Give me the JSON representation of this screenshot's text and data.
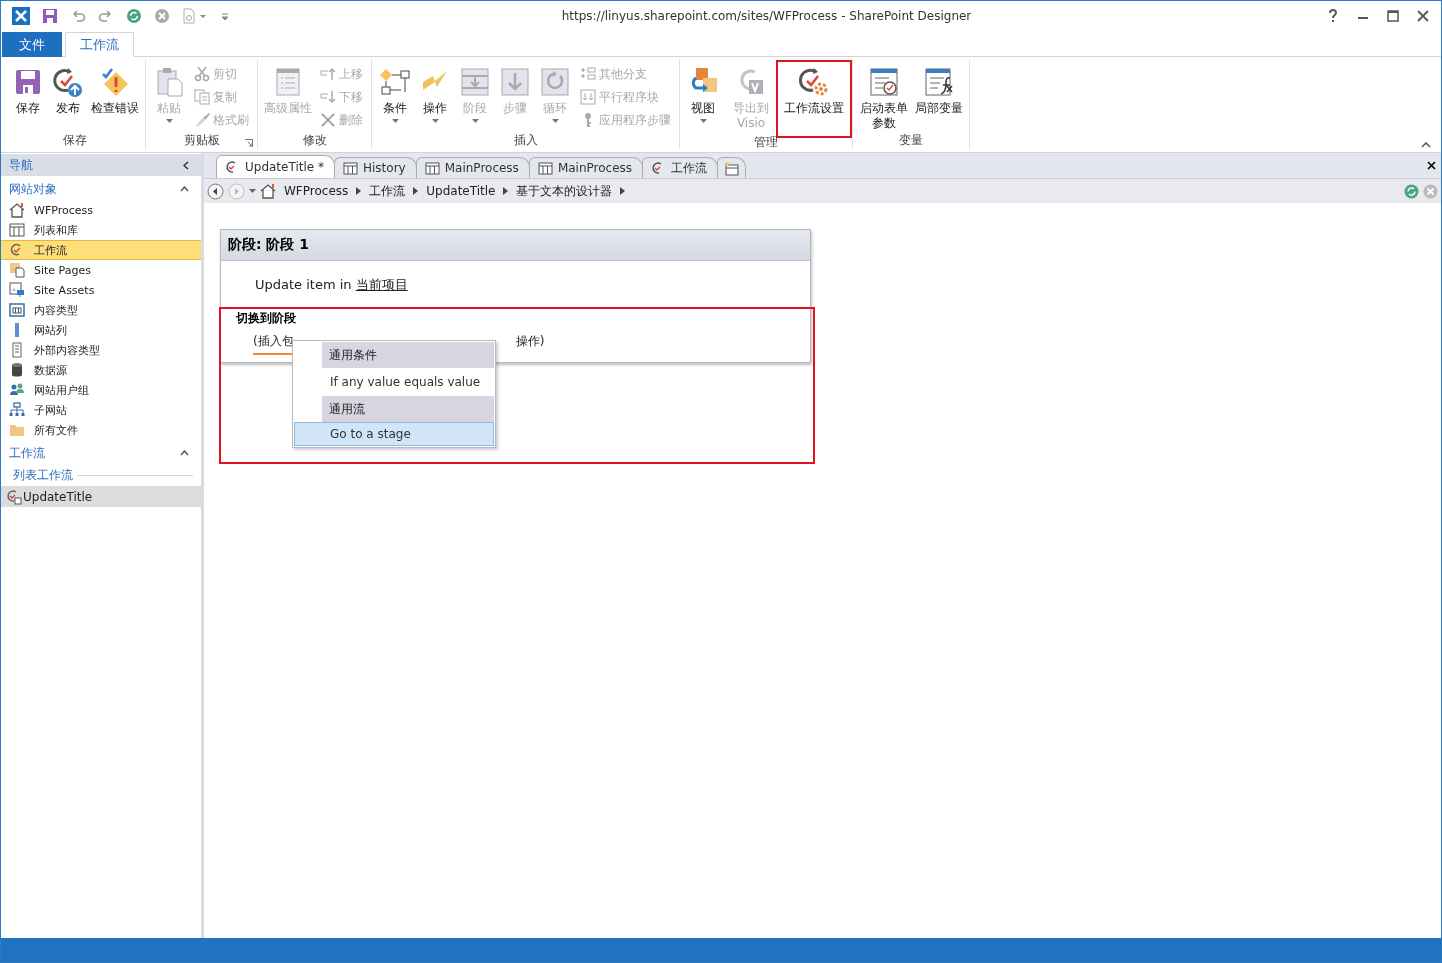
{
  "title_bar": {
    "title": "https://linyus.sharepoint.com/sites/WFProcess - SharePoint Designer"
  },
  "ribbon_tabs": [
    {
      "label": "文件",
      "kind": "file",
      "selected": false
    },
    {
      "label": "工作流",
      "kind": "tab",
      "selected": true
    }
  ],
  "ribbon_groups": [
    {
      "label": "保存",
      "items": [
        {
          "kind": "large",
          "label": "保存",
          "dropdown": false,
          "disabled": false,
          "annotated": false
        },
        {
          "kind": "large",
          "label": "发布",
          "dropdown": false,
          "disabled": false,
          "annotated": false
        },
        {
          "kind": "large",
          "label": "检查错误",
          "dropdown": false,
          "disabled": false,
          "annotated": false
        }
      ]
    },
    {
      "label": "剪贴板",
      "launcher": true,
      "items": [
        {
          "kind": "large",
          "label": "粘贴",
          "dropdown": true,
          "disabled": true,
          "annotated": false
        },
        {
          "kind": "small",
          "label": "剪切",
          "disabled": true
        },
        {
          "kind": "small",
          "label": "复制",
          "disabled": true
        },
        {
          "kind": "small",
          "label": "格式刷",
          "disabled": true
        }
      ]
    },
    {
      "label": "修改",
      "items": [
        {
          "kind": "large",
          "label": "高级属性",
          "dropdown": false,
          "disabled": true,
          "annotated": false
        },
        {
          "kind": "small",
          "label": "上移",
          "disabled": true
        },
        {
          "kind": "small",
          "label": "下移",
          "disabled": true
        },
        {
          "kind": "small",
          "label": "删除",
          "disabled": true
        }
      ]
    },
    {
      "label": "插入",
      "items": [
        {
          "kind": "large",
          "label": "条件",
          "dropdown": true,
          "disabled": false,
          "annotated": false
        },
        {
          "kind": "large",
          "label": "操作",
          "dropdown": true,
          "disabled": false,
          "annotated": false
        },
        {
          "kind": "large",
          "label": "阶段",
          "dropdown": true,
          "disabled": true,
          "annotated": false
        },
        {
          "kind": "large",
          "label": "步骤",
          "dropdown": false,
          "disabled": true,
          "annotated": false
        },
        {
          "kind": "large",
          "label": "循环",
          "dropdown": true,
          "disabled": true,
          "annotated": false
        },
        {
          "kind": "small",
          "label": "其他分支",
          "disabled": true
        },
        {
          "kind": "small",
          "label": "平行程序块",
          "disabled": true
        },
        {
          "kind": "small",
          "label": "应用程序步骤",
          "disabled": true
        }
      ]
    },
    {
      "label": "管理",
      "items": [
        {
          "kind": "large",
          "label": "视图",
          "dropdown": true,
          "disabled": false,
          "annotated": false
        },
        {
          "kind": "large",
          "label": "导出到 Visio",
          "dropdown": false,
          "disabled": true,
          "annotated": false
        },
        {
          "kind": "large",
          "label": "工作流设置",
          "dropdown": false,
          "disabled": false,
          "annotated": true
        }
      ]
    },
    {
      "label": "变量",
      "items": [
        {
          "kind": "large",
          "label": "启动表单参数",
          "dropdown": false,
          "disabled": false,
          "annotated": false
        },
        {
          "kind": "large",
          "label": "局部变量",
          "dropdown": false,
          "disabled": false,
          "annotated": false
        }
      ]
    }
  ],
  "navigation": {
    "header": "导航",
    "sections": [
      {
        "title": "网站对象",
        "expanded": true,
        "items": [
          {
            "label": "WFProcess",
            "selected": false
          },
          {
            "label": "列表和库",
            "selected": false
          },
          {
            "label": "工作流",
            "selected": true
          },
          {
            "label": "Site Pages",
            "selected": false
          },
          {
            "label": "Site Assets",
            "selected": false
          },
          {
            "label": "内容类型",
            "selected": false
          },
          {
            "label": "网站列",
            "selected": false
          },
          {
            "label": "外部内容类型",
            "selected": false
          },
          {
            "label": "数据源",
            "selected": false
          },
          {
            "label": "网站用户组",
            "selected": false
          },
          {
            "label": "子网站",
            "selected": false
          },
          {
            "label": "所有文件",
            "selected": false
          }
        ]
      },
      {
        "title": "工作流",
        "expanded": true,
        "subheading": "列表工作流",
        "items": [
          {
            "label": "UpdateTitle",
            "selected": true
          }
        ]
      }
    ]
  },
  "document_tabs": [
    {
      "kind": "workflow",
      "label": "UpdateTitle *",
      "selected": true
    },
    {
      "kind": "list",
      "label": "History",
      "selected": false
    },
    {
      "kind": "list",
      "label": "MainProcess",
      "selected": false
    },
    {
      "kind": "list",
      "label": "MainProcess",
      "selected": false
    },
    {
      "kind": "workflow",
      "label": "工作流",
      "selected": false
    },
    {
      "kind": "new",
      "selected": false
    }
  ],
  "breadcrumb": [
    "WFProcess",
    "工作流",
    "UpdateTitle",
    "基于文本的设计器"
  ],
  "stage": {
    "title": "阶段: 阶段 1",
    "action_text": "Update item in ",
    "action_link": "当前项目",
    "transition_heading": "切换到阶段",
    "transition_hint_start": "(插入包",
    "transition_hint_end": "操作)",
    "annotated": true
  },
  "context_menu": [
    {
      "kind": "header",
      "label": "通用条件"
    },
    {
      "kind": "item",
      "label": "If any value equals value",
      "selected": false
    },
    {
      "kind": "header",
      "label": "通用流"
    },
    {
      "kind": "item",
      "label": "Go to a stage",
      "selected": true
    }
  ]
}
